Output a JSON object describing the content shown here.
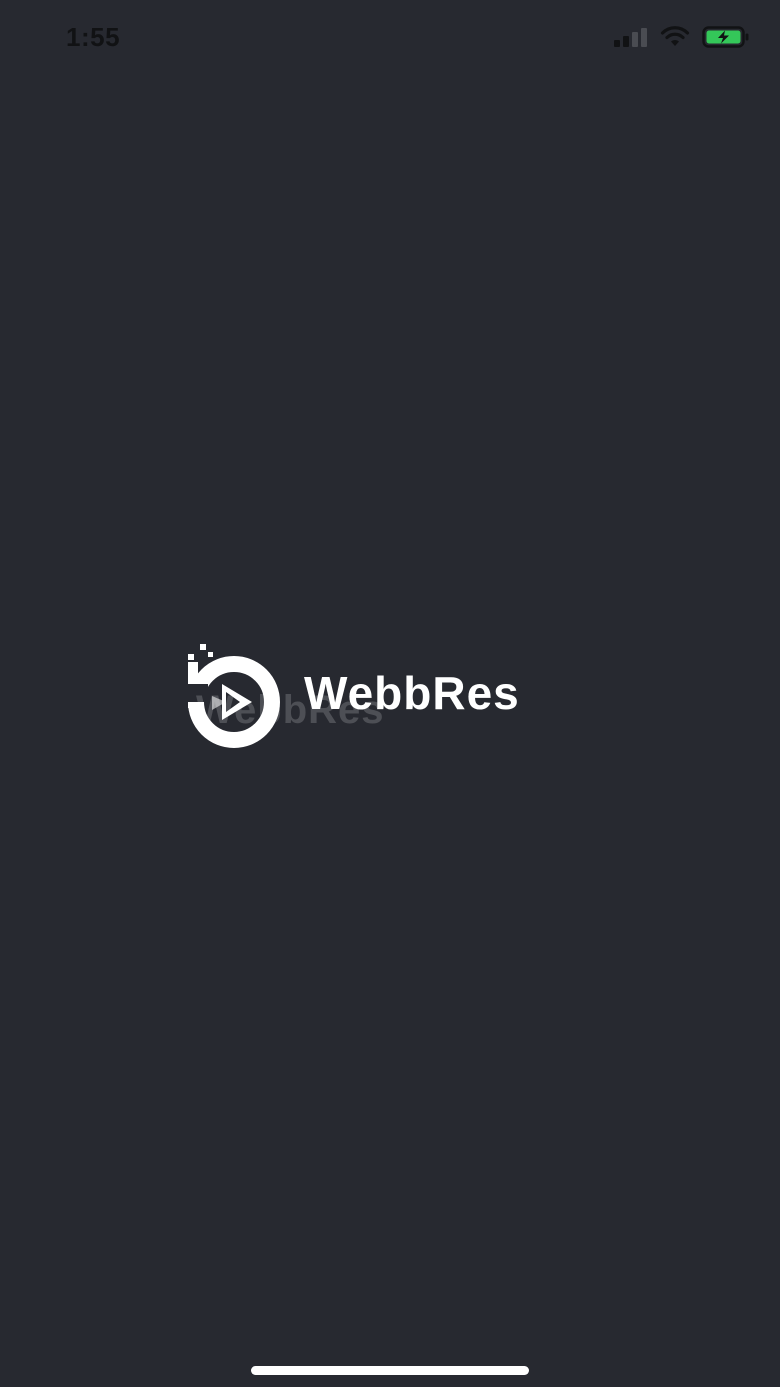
{
  "status_bar": {
    "time": "1:55",
    "icons": [
      "cellular-signal-icon",
      "wifi-icon",
      "battery-charging-icon"
    ],
    "battery_color": "#34c759"
  },
  "splash": {
    "brand_name": "WebbRes",
    "logo_icon": "webbres-logo-icon"
  },
  "colors": {
    "background": "#272930",
    "logo": "#ffffff"
  }
}
